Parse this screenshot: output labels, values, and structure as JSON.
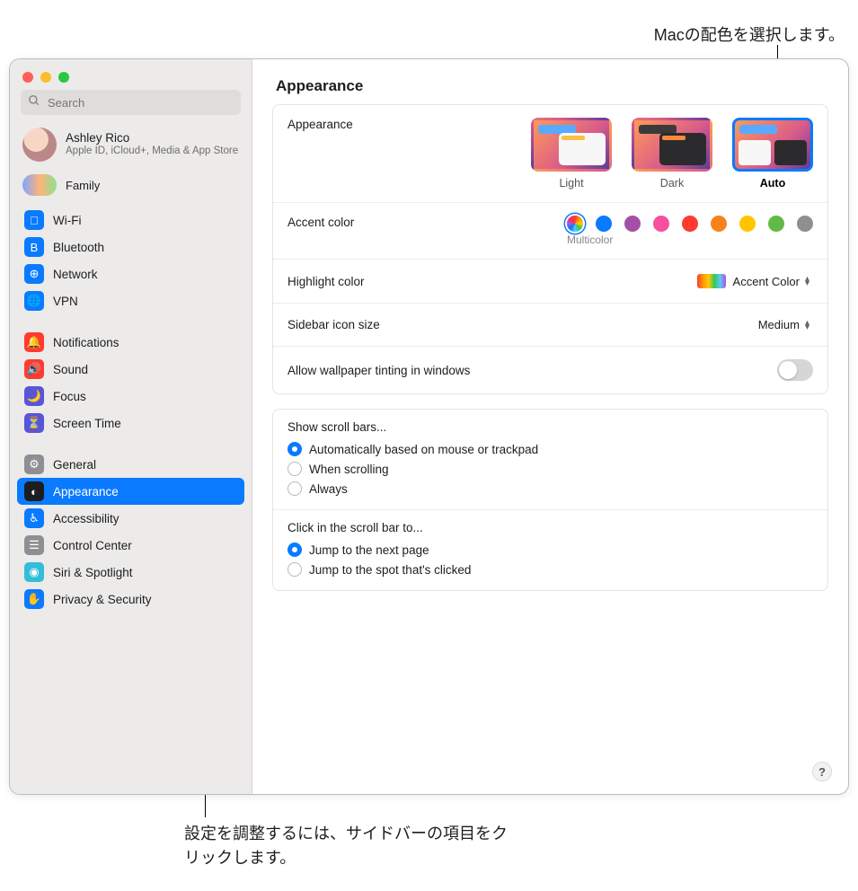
{
  "callouts": {
    "top": "Macの配色を選択します。",
    "bottom": "設定を調整するには、サイドバーの項目をクリックします。"
  },
  "search": {
    "placeholder": "Search"
  },
  "account": {
    "name": "Ashley Rico",
    "sub": "Apple ID, iCloud+, Media & App Store"
  },
  "family": {
    "label": "Family"
  },
  "sidebar": {
    "groups": [
      [
        {
          "label": "Wi-Fi",
          "bg": "#0a7aff",
          "glyph": "􀙇"
        },
        {
          "label": "Bluetooth",
          "bg": "#0a7aff",
          "glyph": "B"
        },
        {
          "label": "Network",
          "bg": "#0a7aff",
          "glyph": "⊕"
        },
        {
          "label": "VPN",
          "bg": "#0a7aff",
          "glyph": "🌐"
        }
      ],
      [
        {
          "label": "Notifications",
          "bg": "#ff3b30",
          "glyph": "🔔"
        },
        {
          "label": "Sound",
          "bg": "#ff3b30",
          "glyph": "🔊"
        },
        {
          "label": "Focus",
          "bg": "#5856d6",
          "glyph": "🌙"
        },
        {
          "label": "Screen Time",
          "bg": "#5856d6",
          "glyph": "⏳"
        }
      ],
      [
        {
          "label": "General",
          "bg": "#8e8e93",
          "glyph": "⚙"
        },
        {
          "label": "Appearance",
          "bg": "#1d1d1f",
          "glyph": "◐",
          "selected": true
        },
        {
          "label": "Accessibility",
          "bg": "#0a7aff",
          "glyph": "♿︎"
        },
        {
          "label": "Control Center",
          "bg": "#8e8e93",
          "glyph": "☰"
        },
        {
          "label": "Siri & Spotlight",
          "bg": "#33bdd8",
          "glyph": "◉"
        },
        {
          "label": "Privacy & Security",
          "bg": "#0a7aff",
          "glyph": "✋"
        }
      ]
    ]
  },
  "main": {
    "title": "Appearance",
    "appearance_row": {
      "label": "Appearance",
      "options": [
        {
          "key": "light",
          "label": "Light"
        },
        {
          "key": "dark",
          "label": "Dark"
        },
        {
          "key": "auto",
          "label": "Auto",
          "selected": true
        }
      ]
    },
    "accent": {
      "label": "Accent color",
      "selected_label": "Multicolor",
      "colors": [
        "multi",
        "#0a7aff",
        "#a550a7",
        "#f74f9e",
        "#ff3b30",
        "#f7821b",
        "#ffc600",
        "#62ba46",
        "#8e8e93"
      ],
      "selected_index": 0
    },
    "highlight": {
      "label": "Highlight color",
      "value": "Accent Color"
    },
    "sidebar_size": {
      "label": "Sidebar icon size",
      "value": "Medium"
    },
    "wallpaper_tint": {
      "label": "Allow wallpaper tinting in windows",
      "on": false
    },
    "scrollbars": {
      "title": "Show scroll bars...",
      "options": [
        "Automatically based on mouse or trackpad",
        "When scrolling",
        "Always"
      ],
      "selected": 0
    },
    "scrollclick": {
      "title": "Click in the scroll bar to...",
      "options": [
        "Jump to the next page",
        "Jump to the spot that's clicked"
      ],
      "selected": 0
    },
    "help": "?"
  }
}
